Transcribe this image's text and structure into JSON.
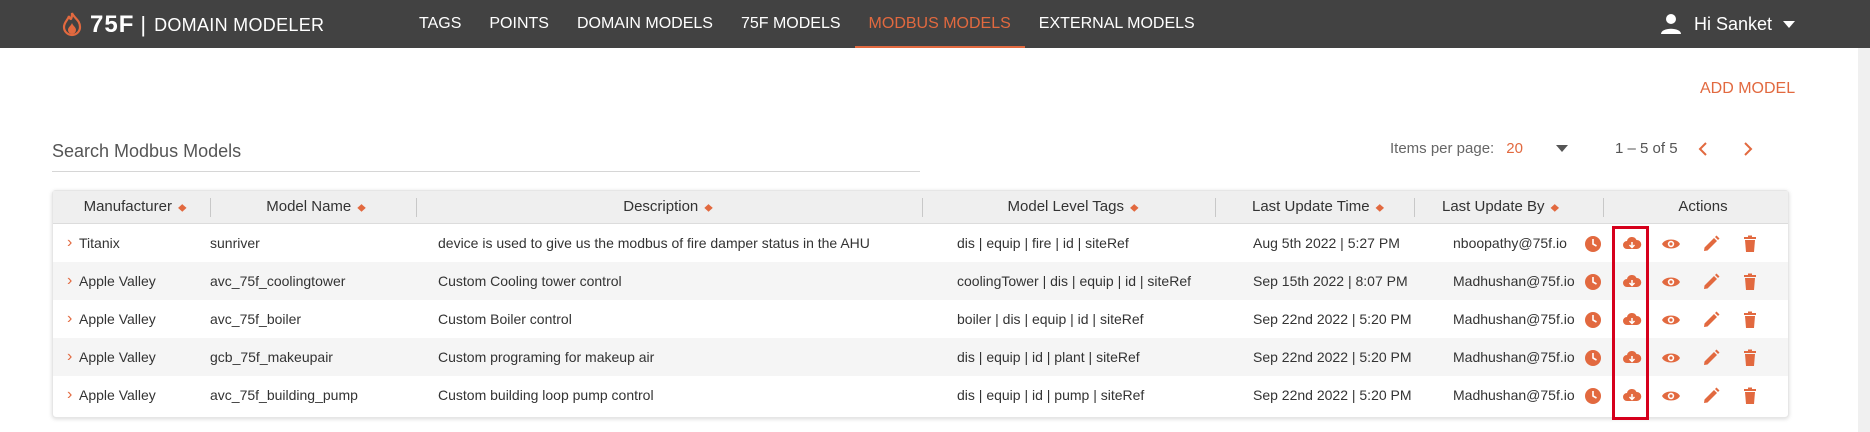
{
  "header": {
    "brand": "75F",
    "separator": "|",
    "app_name": "DOMAIN MODELER",
    "nav": [
      {
        "label": "TAGS",
        "active": false
      },
      {
        "label": "POINTS",
        "active": false
      },
      {
        "label": "DOMAIN MODELS",
        "active": false
      },
      {
        "label": "75F MODELS",
        "active": false
      },
      {
        "label": "MODBUS MODELS",
        "active": true
      },
      {
        "label": "EXTERNAL MODELS",
        "active": false
      }
    ],
    "user_greeting": "Hi Sanket"
  },
  "toolbar": {
    "add_model_label": "ADD MODEL",
    "search_placeholder": "Search Modbus Models",
    "items_per_page_label": "Items per page:",
    "items_per_page_value": "20",
    "range_label": "1 – 5 of 5"
  },
  "table": {
    "columns": [
      "Manufacturer",
      "Model Name",
      "Description",
      "Model Level Tags",
      "Last Update Time",
      "Last Update By",
      "Actions"
    ],
    "rows": [
      {
        "manufacturer": "Titanix",
        "model_name": "sunriver",
        "description": "device is used to give us the modbus of fire damper status in the AHU",
        "tags": "dis | equip | fire | id | siteRef",
        "updated_time": "Aug 5th 2022 | 5:27 PM",
        "updated_by": "nboopathy@75f.io"
      },
      {
        "manufacturer": "Apple Valley",
        "model_name": "avc_75f_coolingtower",
        "description": "Custom Cooling tower control",
        "tags": "coolingTower | dis | equip | id | siteRef",
        "updated_time": "Sep 15th 2022 | 8:07 PM",
        "updated_by": "Madhushan@75f.io"
      },
      {
        "manufacturer": "Apple Valley",
        "model_name": "avc_75f_boiler",
        "description": "Custom Boiler control",
        "tags": "boiler | dis | equip | id | siteRef",
        "updated_time": "Sep 22nd 2022 | 5:20 PM",
        "updated_by": "Madhushan@75f.io"
      },
      {
        "manufacturer": "Apple Valley",
        "model_name": "gcb_75f_makeupair",
        "description": "Custom programing for makeup air",
        "tags": "dis | equip | id | plant | siteRef",
        "updated_time": "Sep 22nd 2022 | 5:20 PM",
        "updated_by": "Madhushan@75f.io"
      },
      {
        "manufacturer": "Apple Valley",
        "model_name": "avc_75f_building_pump",
        "description": "Custom building loop pump control",
        "tags": "dis | equip | id | pump | siteRef",
        "updated_time": "Sep 22nd 2022 | 5:20 PM",
        "updated_by": "Madhushan@75f.io"
      }
    ],
    "action_icons": [
      "history-icon",
      "download-icon",
      "view-icon",
      "edit-icon",
      "delete-icon"
    ]
  },
  "colors": {
    "accent": "#e2693f",
    "topbar": "#424242",
    "highlight": "#d6001c"
  }
}
